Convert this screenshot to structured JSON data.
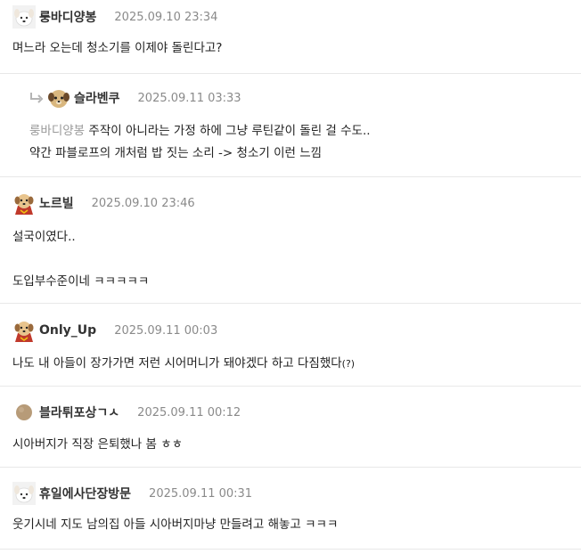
{
  "comments": [
    {
      "nickname": "룽바디양봉",
      "date": "2025.09.10 23:34",
      "avatar": "dog-white-avatar",
      "lines": [
        "며느라 오는데 청소기를 이제야 돌린다고?"
      ]
    },
    {
      "nickname": "슬라벤쿠",
      "date": "2025.09.11 03:33",
      "avatar": "dog-round-avatar",
      "is_reply": true,
      "mention": "룽바디양봉",
      "line1_rest": " 주작이 아니라는 가정 하에 그냥 루틴같이 돌린 걸 수도..",
      "line2": "약간 파블로프의 개처럼 밥 짓는 소리 -> 청소기 이런 느낌"
    },
    {
      "nickname": "노르빌",
      "date": "2025.09.10 23:46",
      "avatar": "dog-cape-avatar",
      "line1": "설국이였다..",
      "line2": "도입부수준이네 ㅋㅋㅋㅋㅋ"
    },
    {
      "nickname": "Only_Up",
      "date": "2025.09.11 00:03",
      "avatar": "dog-cape-avatar",
      "line1_main": "나도 내 아들이 장가가면 저런 시어머니가 돼야겠다 하고 다짐했다",
      "line1_small": "(?)"
    },
    {
      "nickname": "블라튀포상ㄱㅅ",
      "date": "2025.09.11 00:12",
      "avatar": "brown-circle-avatar",
      "line1": "시아버지가 직장 은퇴했나 봄 ㅎㅎ"
    },
    {
      "nickname": "휴일에사단장방문",
      "date": "2025.09.11 00:31",
      "avatar": "dog-white-avatar",
      "line1": "웃기시네 지도 남의집 아들 시아버지마냥 만들려고 해놓고 ㅋㅋㅋ"
    }
  ],
  "icons": {
    "reply": "reply-arrow-icon"
  },
  "colors": {
    "date": "#8a8a8a",
    "mention": "#9a9a9a",
    "divider": "#e8e8e8",
    "text": "#222222"
  }
}
